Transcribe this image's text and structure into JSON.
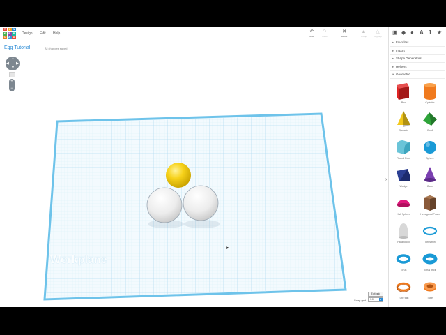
{
  "app": {
    "logo_letters": [
      "TIN",
      "KER",
      "CAD"
    ],
    "logo_colors": [
      "#e84e40",
      "#f6a623",
      "#2a8bd6",
      "#4caf50",
      "#8e44ad",
      "#1abc9c",
      "#e67e22",
      "#3498db",
      "#e74c3c"
    ]
  },
  "menu": {
    "items": [
      "Design",
      "Edit",
      "Help"
    ]
  },
  "toolbar": {
    "tools": [
      {
        "name": "undo",
        "icon": "undo-icon",
        "label": "Undo",
        "enabled": true
      },
      {
        "name": "redo",
        "icon": "redo-icon",
        "label": "Redo",
        "enabled": false
      },
      {
        "name": "adjust",
        "icon": "adjust-icon",
        "label": "Adjust",
        "enabled": true
      },
      {
        "name": "group",
        "icon": "group-icon",
        "label": "Group",
        "enabled": false
      },
      {
        "name": "ungroup",
        "icon": "ungroup-icon",
        "label": "Ungroup",
        "enabled": false
      }
    ]
  },
  "project": {
    "title": "Egg Tutorial",
    "status": "All changes saved"
  },
  "workplane": {
    "label": "Workplane",
    "grid_color": "#9fd1ea",
    "border_color": "#4cb3e6"
  },
  "scene": {
    "objects": [
      {
        "name": "yellow-sphere",
        "color": "#f7d21a"
      },
      {
        "name": "white-sphere-left",
        "color": "#f2f2f2"
      },
      {
        "name": "white-sphere-right",
        "color": "#f2f2f2"
      }
    ]
  },
  "grid_controls": {
    "edit_grid_label": "Edit grid",
    "snap_grid_label": "Snap grid",
    "snap_grid_value": "1.0"
  },
  "panel": {
    "toolbar_icons": [
      "box-view-icon",
      "cube-icon",
      "sphere-icon",
      "text-icon",
      "number-icon",
      "star-icon"
    ],
    "toolbar_glyphs": [
      "A",
      "1",
      "★"
    ],
    "categories": [
      "Favorites",
      "Import",
      "Shape Generators",
      "Helpers",
      "Geometric"
    ],
    "shapes": [
      {
        "label": "Box",
        "color": "#e02424"
      },
      {
        "label": "Cylinder",
        "color": "#f07a1e"
      },
      {
        "label": "Pyramid",
        "color": "#f2c81b"
      },
      {
        "label": "Roof",
        "color": "#2fa43a"
      },
      {
        "label": "Round Roof",
        "color": "#6ac4d8"
      },
      {
        "label": "Sphere",
        "color": "#1a9ad6"
      },
      {
        "label": "Wedge",
        "color": "#2b3f93"
      },
      {
        "label": "Cone",
        "color": "#7a3fb0"
      },
      {
        "label": "Half Sphere",
        "color": "#e0197d"
      },
      {
        "label": "Hexagonal Prism",
        "color": "#8a5a3a"
      },
      {
        "label": "Paraboloid",
        "color": "#d8d8d8"
      },
      {
        "label": "Torus thin",
        "color": "#1a9ad6"
      },
      {
        "label": "Torus",
        "color": "#1a9ad6"
      },
      {
        "label": "Torus thick",
        "color": "#1a9ad6"
      },
      {
        "label": "Tube thin",
        "color": "#f07a1e"
      },
      {
        "label": "Tube",
        "color": "#f07a1e"
      }
    ]
  }
}
